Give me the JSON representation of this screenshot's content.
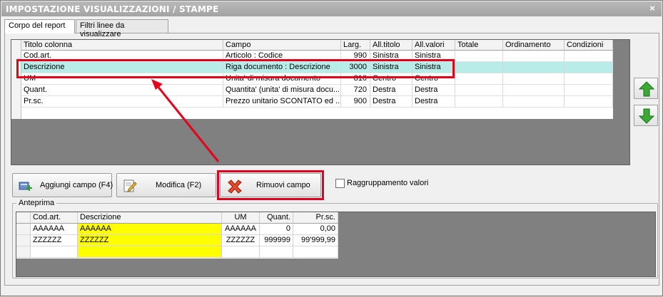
{
  "window": {
    "title": "IMPOSTAZIONE VISUALIZZAZIONI / STAMPE",
    "close_glyph": "×"
  },
  "tabs": [
    {
      "label": "Corpo del report"
    },
    {
      "label": "Filtri linee da visualizzare"
    }
  ],
  "grid": {
    "headers": [
      "Titolo colonna",
      "Campo",
      "Larg.",
      "All.titolo",
      "All.valori",
      "Totale",
      "Ordinamento",
      "Condizioni"
    ],
    "rows": [
      {
        "titolo": "Cod.art.",
        "campo": "Articolo : Codice",
        "larg": "990",
        "all_titolo": "Sinistra",
        "all_valori": "Sinistra",
        "totale": "",
        "ordinamento": "",
        "condizioni": ""
      },
      {
        "titolo": "Descrizione",
        "campo": "Riga documento : Descrizione",
        "larg": "3000",
        "all_titolo": "Sinistra",
        "all_valori": "Sinistra",
        "totale": "",
        "ordinamento": "",
        "condizioni": ""
      },
      {
        "titolo": "UM",
        "campo": "Unita' di misura documento",
        "larg": "810",
        "all_titolo": "Centro",
        "all_valori": "Centro",
        "totale": "",
        "ordinamento": "",
        "condizioni": ""
      },
      {
        "titolo": "Quant.",
        "campo": "Quantita' (unita' di misura docu...",
        "larg": "720",
        "all_titolo": "Destra",
        "all_valori": "Destra",
        "totale": "",
        "ordinamento": "",
        "condizioni": ""
      },
      {
        "titolo": "Pr.sc.",
        "campo": "Prezzo unitario SCONTATO ed ...",
        "larg": "900",
        "all_titolo": "Destra",
        "all_valori": "Destra",
        "totale": "",
        "ordinamento": "",
        "condizioni": ""
      }
    ]
  },
  "buttons": {
    "aggiungi": "Aggiungi campo (F4)",
    "modifica": "Modifica (F2)",
    "rimuovi": "Rimuovi campo"
  },
  "checkbox": {
    "label": "Raggruppamento valori",
    "checked": false
  },
  "anteprima": {
    "legend": "Anteprima",
    "headers": [
      "Cod.art.",
      "Descrizione",
      "UM",
      "Quant.",
      "Pr.sc."
    ],
    "rows": [
      [
        "AAAAAA",
        "AAAAAA",
        "AAAAAA",
        "0",
        "0,00"
      ],
      [
        "ZZZZZZ",
        "ZZZZZZ",
        "ZZZZZZ",
        "999999",
        "99'999,99"
      ]
    ]
  },
  "colors": {
    "highlight": "#e3001b",
    "selected_row": "#b7ece8",
    "preview_desc": "#ffff00",
    "arrow_green": "#2f9e2f"
  },
  "icons": [
    "close-icon",
    "add-field-icon",
    "edit-icon",
    "remove-icon",
    "arrow-up-icon",
    "arrow-down-icon"
  ]
}
